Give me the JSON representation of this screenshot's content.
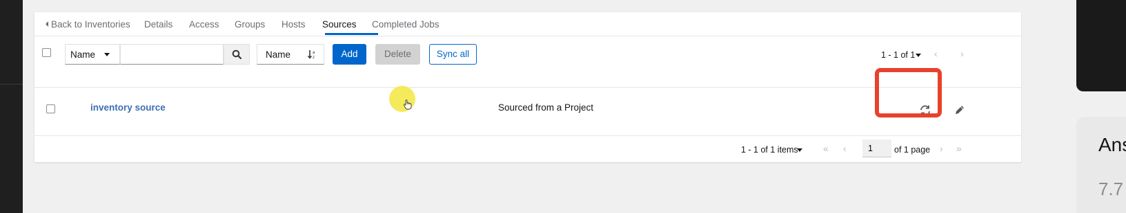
{
  "tabs": [
    {
      "label": "Back to Inventories",
      "active": false
    },
    {
      "label": "Details",
      "active": false
    },
    {
      "label": "Access",
      "active": false
    },
    {
      "label": "Groups",
      "active": false
    },
    {
      "label": "Hosts",
      "active": false
    },
    {
      "label": "Sources",
      "active": true
    },
    {
      "label": "Completed Jobs",
      "active": false
    }
  ],
  "toolbar": {
    "filter_field": "Name",
    "search_placeholder": "",
    "sort_field": "Name",
    "add_label": "Add",
    "delete_label": "Delete",
    "sync_all_label": "Sync all",
    "pagination": "1 - 1 of 1"
  },
  "rows": [
    {
      "name": "inventory source",
      "type": "Sourced from a Project"
    }
  ],
  "pagination": {
    "items_label": "1 - 1 of 1 items",
    "page": "1",
    "of_pages": "of 1 page"
  },
  "right_panel": {
    "title_fragment": "Ans",
    "value_fragment": "7.7"
  },
  "colors": {
    "accent": "#0066cc",
    "highlight": "#e8412c",
    "cursor": "#f4e84a"
  }
}
